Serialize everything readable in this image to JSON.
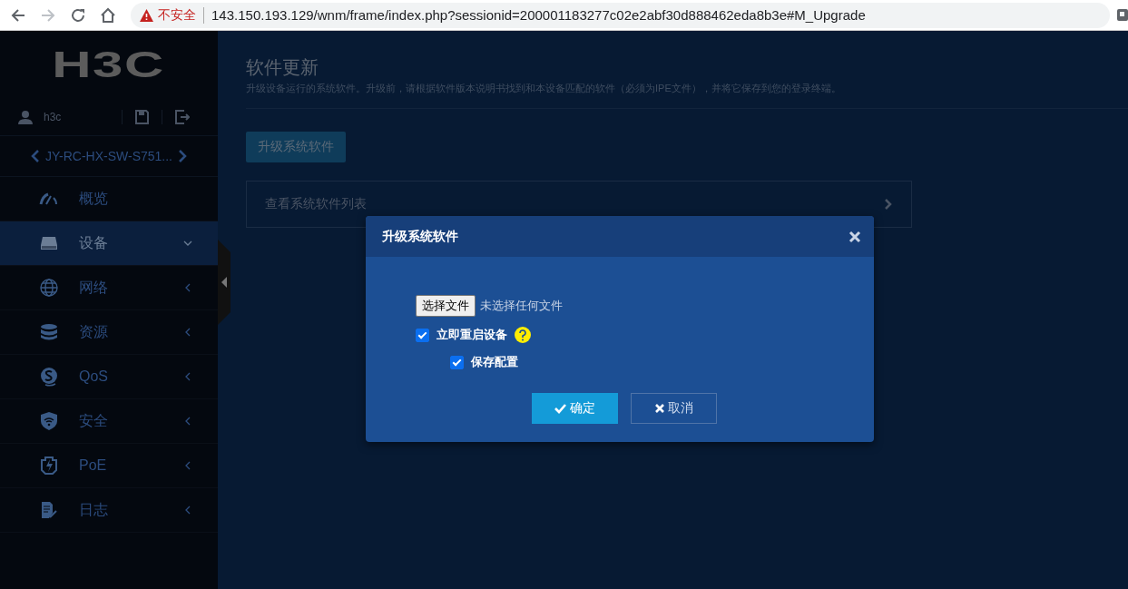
{
  "browser": {
    "security_label": "不安全",
    "url": "143.150.193.129/wnm/frame/index.php?sessionid=200001183277c02e2abf30d888462eda8b3e#M_Upgrade",
    "forward_disabled": true
  },
  "sidebar": {
    "logo": "H3C",
    "user": "h3c",
    "device": "JY-RC-HX-SW-S751...",
    "items": [
      {
        "label": "概览",
        "kind": "link",
        "selected": false
      },
      {
        "label": "设备",
        "kind": "group",
        "selected": true,
        "expanded": true
      },
      {
        "label": "网络",
        "kind": "group",
        "selected": false,
        "expanded": false
      },
      {
        "label": "资源",
        "kind": "group",
        "selected": false,
        "expanded": false
      },
      {
        "label": "QoS",
        "kind": "group",
        "selected": false,
        "expanded": false
      },
      {
        "label": "安全",
        "kind": "group",
        "selected": false,
        "expanded": false
      },
      {
        "label": "PoE",
        "kind": "group",
        "selected": false,
        "expanded": false
      },
      {
        "label": "日志",
        "kind": "group",
        "selected": false,
        "expanded": false
      }
    ]
  },
  "main": {
    "title": "软件更新",
    "description": "升级设备运行的系统软件。升级前，请根据软件版本说明书找到和本设备匹配的软件（必须为IPE文件），并将它保存到您的登录终端。",
    "upgrade_button": "升级系统软件",
    "list_panel": "查看系统软件列表"
  },
  "dialog": {
    "title": "升级系统软件",
    "file_button": "选择文件",
    "file_status": "未选择任何文件",
    "options": [
      {
        "label": "立即重启设备",
        "checked": true,
        "help": true
      },
      {
        "label": "保存配置",
        "checked": true,
        "help": false
      }
    ],
    "ok": "确定",
    "cancel": "取消"
  }
}
